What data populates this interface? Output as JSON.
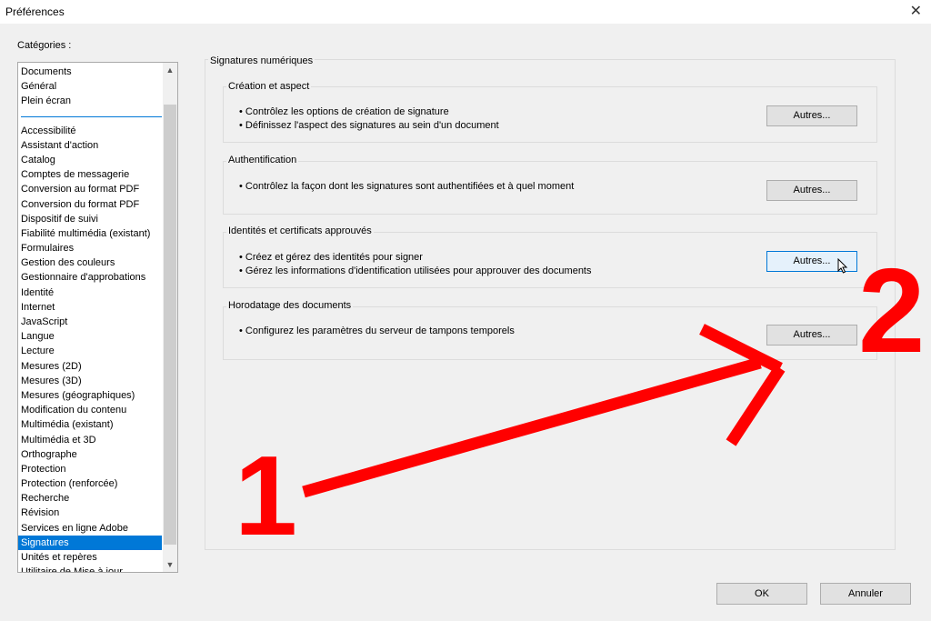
{
  "window": {
    "title": "Préférences",
    "close_glyph": "✕"
  },
  "categories_label": "Catégories :",
  "categories": {
    "top": [
      "Documents",
      "Général",
      "Plein écran"
    ],
    "items": [
      "Accessibilité",
      "Assistant d'action",
      "Catalog",
      "Comptes de messagerie",
      "Conversion au format PDF",
      "Conversion du format PDF",
      "Dispositif de suivi",
      "Fiabilité multimédia (existant)",
      "Formulaires",
      "Gestion des couleurs",
      "Gestionnaire d'approbations",
      "Identité",
      "Internet",
      "JavaScript",
      "Langue",
      "Lecture",
      "Mesures (2D)",
      "Mesures (3D)",
      "Mesures (géographiques)",
      "Modification du contenu",
      "Multimédia (existant)",
      "Multimédia et 3D",
      "Orthographe",
      "Protection",
      "Protection (renforcée)",
      "Recherche",
      "Révision",
      "Services en ligne Adobe",
      "Signatures",
      "Unités et repères",
      "Utilitaire de Mise à jour"
    ],
    "selected": "Signatures"
  },
  "panel": {
    "title": "Signatures numériques",
    "groups": [
      {
        "title": "Création et aspect",
        "bullets": [
          "• Contrôlez les options de création de signature",
          "• Définissez l'aspect des signatures au sein d'un document"
        ],
        "button": "Autres..."
      },
      {
        "title": "Authentification",
        "bullets": [
          "• Contrôlez la façon dont les signatures sont authentifiées et à quel moment"
        ],
        "button": "Autres..."
      },
      {
        "title": "Identités et certificats approuvés",
        "bullets": [
          "• Créez et gérez des identités pour signer",
          "• Gérez les informations d'identification utilisées pour approuver des documents"
        ],
        "button": "Autres..."
      },
      {
        "title": "Horodatage des documents",
        "bullets": [
          "• Configurez les paramètres du serveur de tampons temporels"
        ],
        "button": "Autres..."
      }
    ]
  },
  "footer": {
    "ok": "OK",
    "cancel": "Annuler"
  },
  "annotations": {
    "step1": "1",
    "step2": "2",
    "color": "#ff0000"
  },
  "colors": {
    "selection": "#0078d7",
    "background": "#f0f0f0"
  }
}
